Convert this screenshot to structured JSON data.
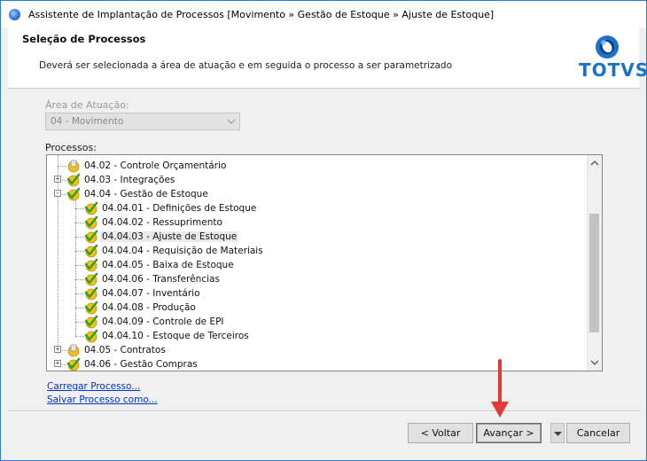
{
  "window": {
    "title": "Assistente de Implantação de Processos [Movimento » Gestão de Estoque » Ajuste de Estoque]"
  },
  "header": {
    "title": "Seleção de Processos",
    "description": "Deverá ser selecionada a área de atuação e em seguida o processo a ser parametrizado",
    "logo_text": "TOTVS"
  },
  "area": {
    "label": "Área de Atuação:",
    "value": "04 - Movimento"
  },
  "processes": {
    "label": "Processos:",
    "items": [
      {
        "label": "04.02 - Controle Orçamentário",
        "level": 0,
        "expander": "",
        "icon": "partial-icon"
      },
      {
        "label": "04.03 - Integrações",
        "level": 0,
        "expander": "+",
        "icon": "checked-icon"
      },
      {
        "label": "04.04 - Gestão de Estoque",
        "level": 0,
        "expander": "-",
        "icon": "checked-icon"
      },
      {
        "label": "04.04.01 - Definições de Estoque",
        "level": 1,
        "expander": "",
        "icon": "checked-icon"
      },
      {
        "label": "04.04.02 - Ressuprimento",
        "level": 1,
        "expander": "",
        "icon": "checked-icon"
      },
      {
        "label": "04.04.03 - Ajuste de Estoque",
        "level": 1,
        "expander": "",
        "icon": "checked-icon",
        "selected": true
      },
      {
        "label": "04.04.04 - Requisição de Materiais",
        "level": 1,
        "expander": "",
        "icon": "checked-icon"
      },
      {
        "label": "04.04.05 - Baixa de Estoque",
        "level": 1,
        "expander": "",
        "icon": "checked-icon"
      },
      {
        "label": "04.04.06 - Transferências",
        "level": 1,
        "expander": "",
        "icon": "checked-icon"
      },
      {
        "label": "04.04.07 - Inventário",
        "level": 1,
        "expander": "",
        "icon": "checked-icon"
      },
      {
        "label": "04.04.08 - Produção",
        "level": 1,
        "expander": "",
        "icon": "checked-icon"
      },
      {
        "label": "04.04.09 - Controle de EPI",
        "level": 1,
        "expander": "",
        "icon": "checked-icon"
      },
      {
        "label": "04.04.10 - Estoque de Terceiros",
        "level": 1,
        "expander": "",
        "icon": "checked-icon"
      },
      {
        "label": "04.05 - Contratos",
        "level": 0,
        "expander": "+",
        "icon": "partial-icon"
      },
      {
        "label": "04.06 - Gestão Compras",
        "level": 0,
        "expander": "+",
        "icon": "checked-icon"
      }
    ]
  },
  "links": {
    "load": "Carregar Processo...",
    "save": "Salvar Processo como..."
  },
  "buttons": {
    "back": "< Voltar",
    "next": "Avançar >",
    "cancel": "Cancelar"
  },
  "colors": {
    "accent": "#1b72c8",
    "link": "#0033cc",
    "arrow": "#e53935",
    "check": "#3a9d23",
    "coin": "#f2c21b"
  }
}
